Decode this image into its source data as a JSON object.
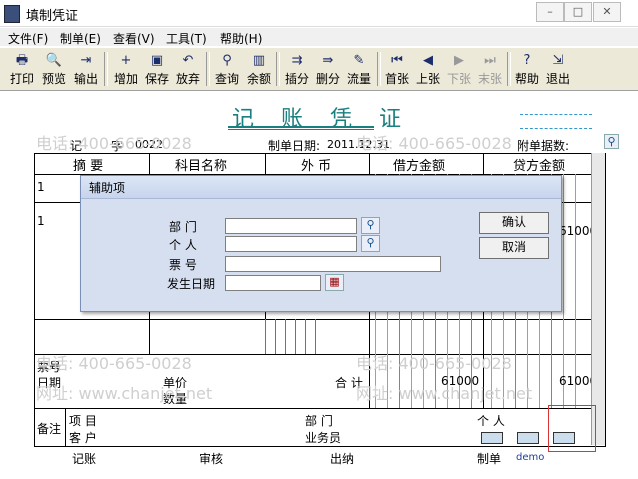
{
  "window": {
    "title": "填制凭证",
    "controls": [
      "minimize",
      "maximize",
      "close"
    ]
  },
  "menu": [
    {
      "label": "文件(F)"
    },
    {
      "label": "制单(E)"
    },
    {
      "label": "查看(V)"
    },
    {
      "label": "工具(T)"
    },
    {
      "label": "帮助(H)"
    }
  ],
  "toolbar": [
    {
      "label": "打印",
      "icon": "printer-icon",
      "glyph": "🖶",
      "enabled": true
    },
    {
      "label": "预览",
      "icon": "preview-icon",
      "glyph": "🔍",
      "enabled": true
    },
    {
      "label": "输出",
      "icon": "export-icon",
      "glyph": "⇥",
      "enabled": true
    },
    {
      "label": "增加",
      "icon": "add-icon",
      "glyph": "+",
      "enabled": true
    },
    {
      "label": "保存",
      "icon": "save-icon",
      "glyph": "▣",
      "enabled": true
    },
    {
      "label": "放弃",
      "icon": "undo-icon",
      "glyph": "↶",
      "enabled": true
    },
    {
      "label": "查询",
      "icon": "binoculars-icon",
      "glyph": "⚲",
      "enabled": true
    },
    {
      "label": "余额",
      "icon": "bar-chart-icon",
      "glyph": "▥",
      "enabled": true
    },
    {
      "label": "插分",
      "icon": "insert-row-icon",
      "glyph": "⇉",
      "enabled": true
    },
    {
      "label": "删分",
      "icon": "delete-row-icon",
      "glyph": "⇛",
      "enabled": true
    },
    {
      "label": "流量",
      "icon": "flow-icon",
      "glyph": "✎",
      "enabled": true
    },
    {
      "label": "首张",
      "icon": "first-icon",
      "glyph": "⏮",
      "enabled": true
    },
    {
      "label": "上张",
      "icon": "previous-icon",
      "glyph": "◀",
      "enabled": true
    },
    {
      "label": "下张",
      "icon": "next-icon",
      "glyph": "▶",
      "enabled": false
    },
    {
      "label": "末张",
      "icon": "last-icon",
      "glyph": "⏭",
      "enabled": false
    },
    {
      "label": "帮助",
      "icon": "help-icon",
      "glyph": "?",
      "enabled": true
    },
    {
      "label": "退出",
      "icon": "exit-icon",
      "glyph": "⇲",
      "enabled": true
    }
  ],
  "voucher": {
    "title": "记 账 凭 证",
    "type_label": "记",
    "number_label": "字",
    "number": "0022",
    "date_label": "制单日期:",
    "date": "2011.12.31",
    "attachments_label": "附单据数:",
    "columns": [
      "摘 要",
      "科目名称",
      "外 币",
      "借方金额",
      "贷方金额"
    ],
    "rows": [
      {
        "index": "1",
        "amount": ""
      },
      {
        "index": "1",
        "amount": "61000"
      }
    ],
    "bill_no_label": "票号",
    "bill_date_label": "日期",
    "unit_price_label": "单价",
    "quantity_label": "数量",
    "total_label": "合 计",
    "total_debit": "61000",
    "total_credit": "61000",
    "remarks_label": "备注",
    "project_label": "项 目",
    "customer_label": "客 户",
    "department_label": "部 门",
    "salesman_label": "业务员",
    "person_label": "个 人"
  },
  "dialog": {
    "title": "辅助项",
    "fields": [
      {
        "label": "部 门",
        "value": ""
      },
      {
        "label": "个 人",
        "value": ""
      },
      {
        "label": "票 号",
        "value": ""
      },
      {
        "label": "发生日期",
        "value": ""
      }
    ],
    "ok_label": "确认",
    "cancel_label": "取消"
  },
  "footer": {
    "bookkeeping_label": "记账",
    "review_label": "审核",
    "cashier_label": "出纳",
    "maker_label": "制单",
    "maker_name": "demo"
  },
  "watermarks": [
    "电话: 400-665-0028",
    "网址: www.chanjet.net"
  ]
}
